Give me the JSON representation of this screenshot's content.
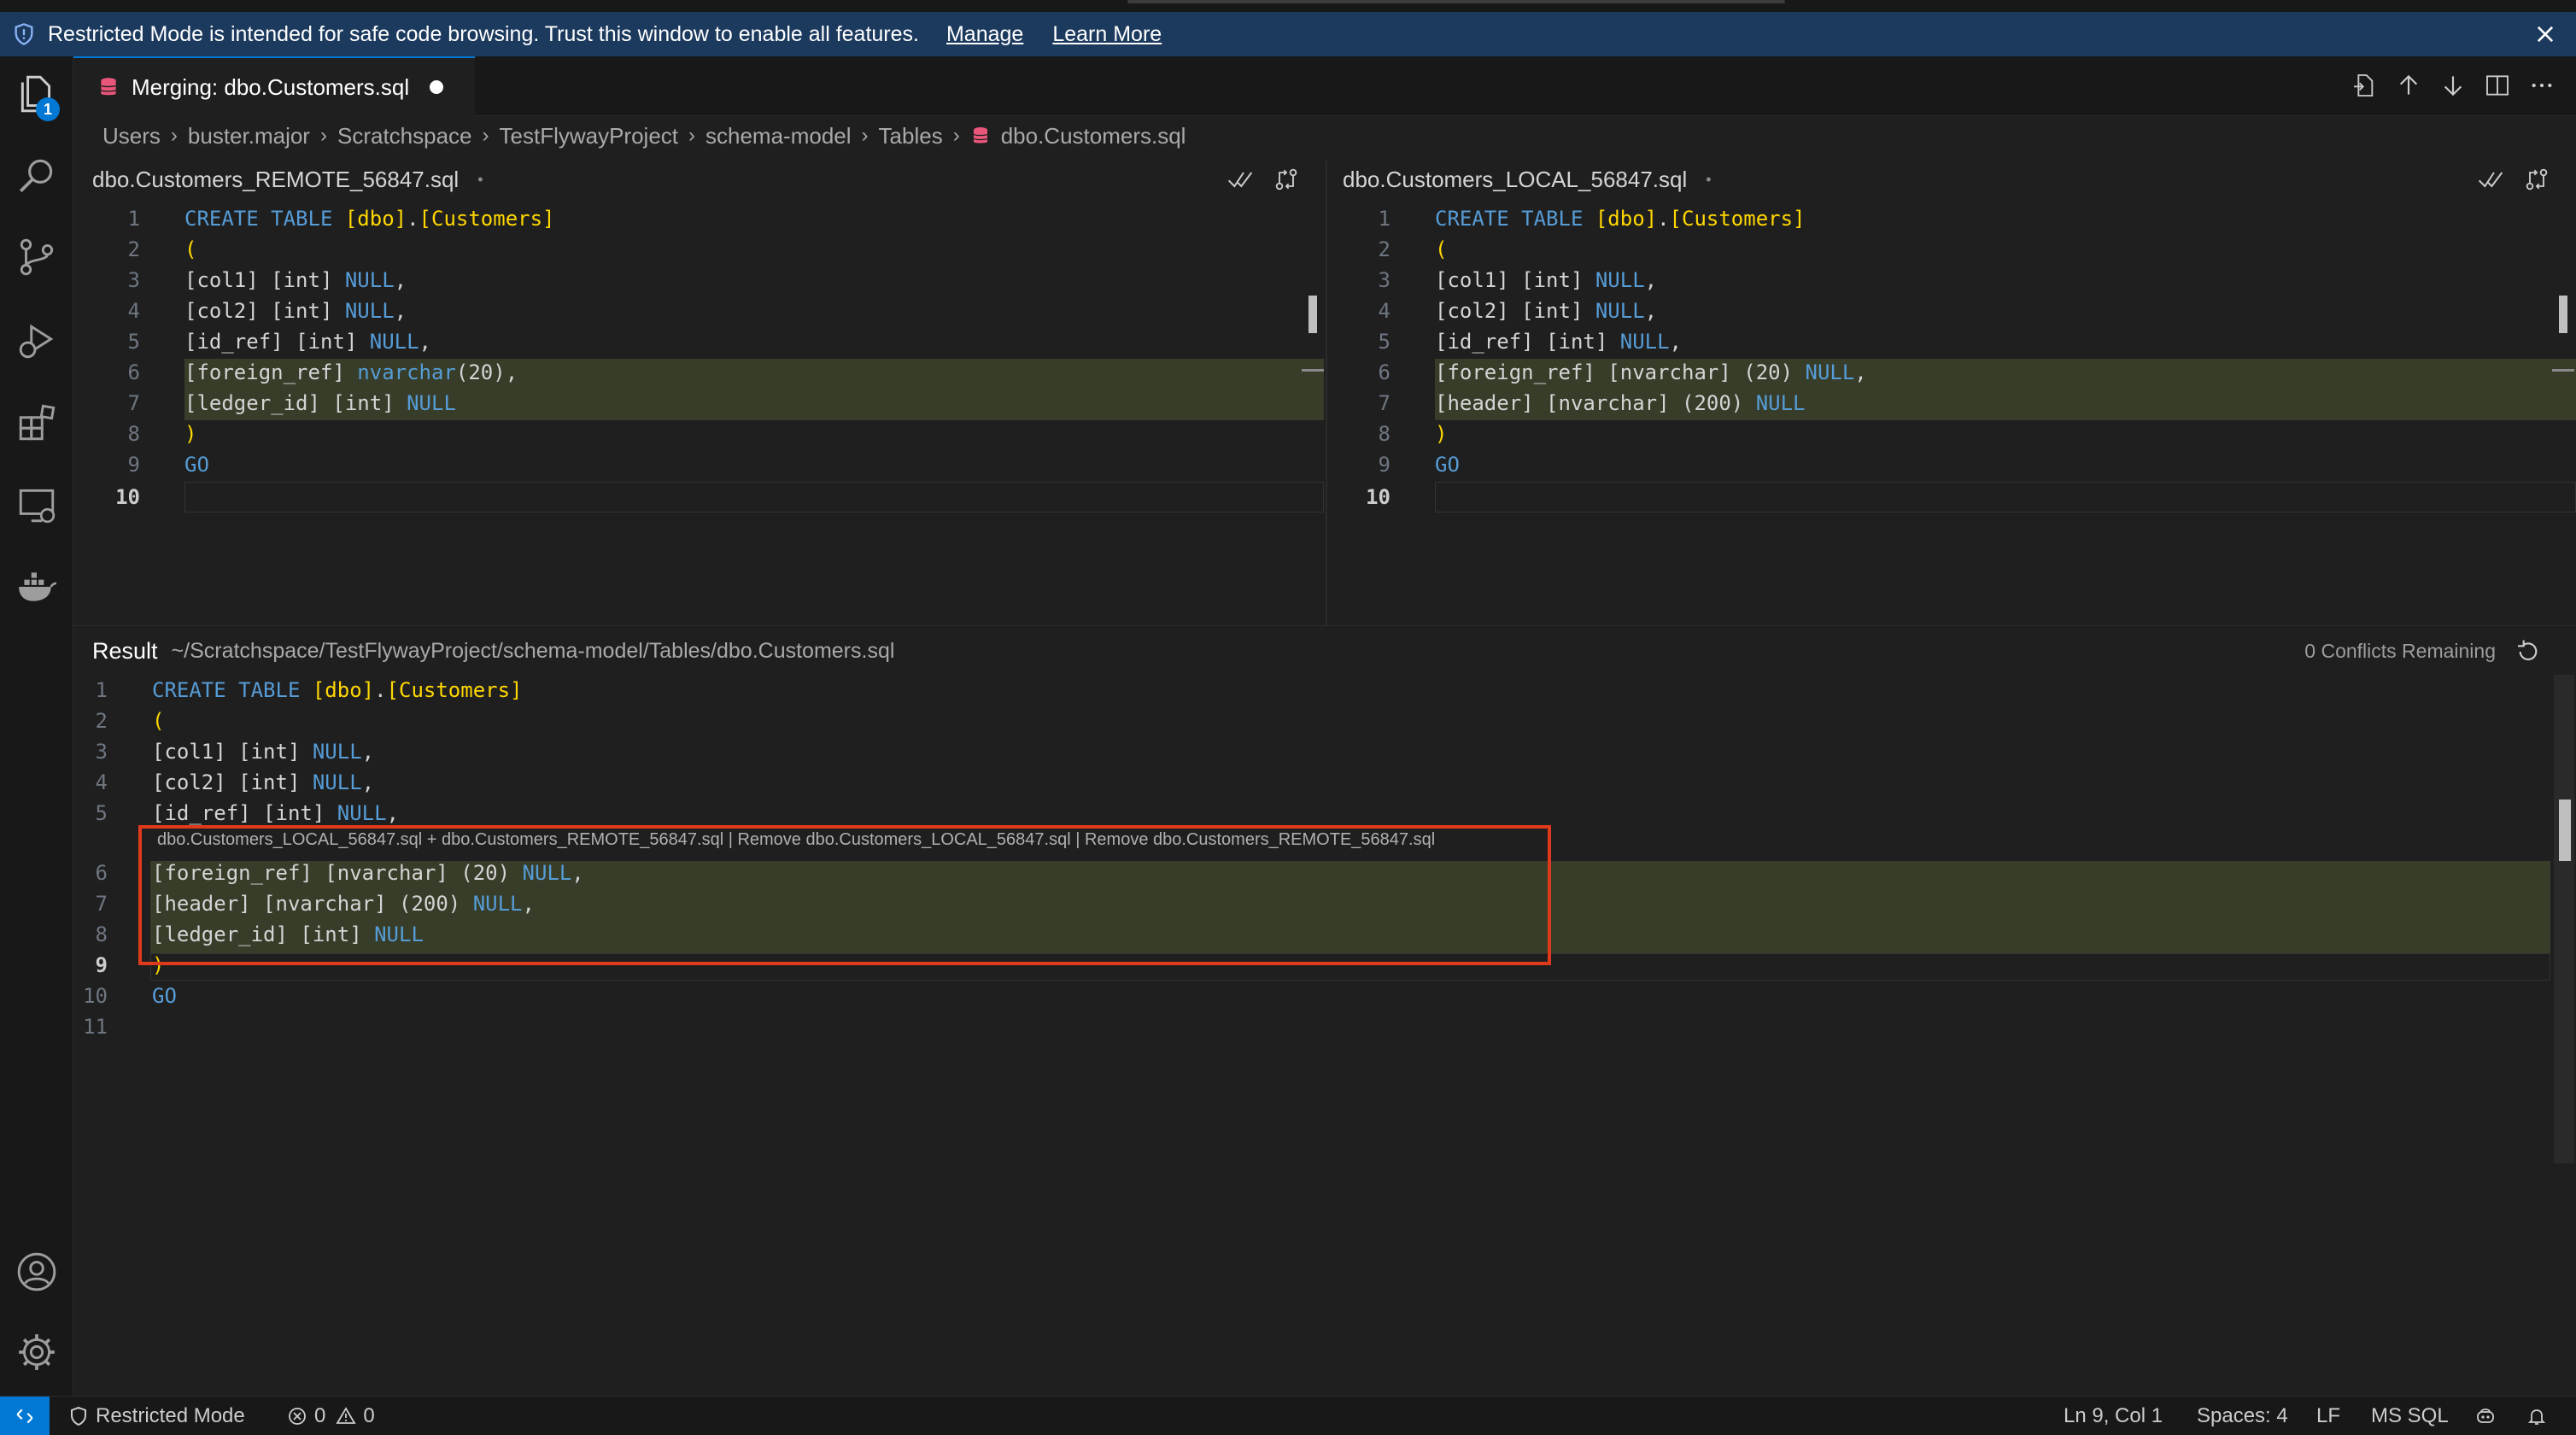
{
  "banner": {
    "message": "Restricted Mode is intended for safe code browsing. Trust this window to enable all features.",
    "manage": "Manage",
    "learn_more": "Learn More"
  },
  "activity": {
    "explorer_badge": "1"
  },
  "tab": {
    "title": "Merging: dbo.Customers.sql"
  },
  "breadcrumb": [
    "Users",
    "buster.major",
    "Scratchspace",
    "TestFlywayProject",
    "schema-model",
    "Tables",
    "dbo.Customers.sql"
  ],
  "left_pane": {
    "title": "dbo.Customers_REMOTE_56847.sql",
    "dot": "•",
    "line_numbers": [
      "1",
      "2",
      "3",
      "4",
      "5",
      "6",
      "7",
      "8",
      "9",
      "10"
    ],
    "current_line": "10"
  },
  "right_pane": {
    "title": "dbo.Customers_LOCAL_56847.sql",
    "dot": "•",
    "line_numbers": [
      "1",
      "2",
      "3",
      "4",
      "5",
      "6",
      "7",
      "8",
      "9",
      "10"
    ],
    "current_line": "10"
  },
  "result": {
    "title": "Result",
    "path": "~/Scratchspace/TestFlywayProject/schema-model/Tables/dbo.Customers.sql",
    "conflicts": "0 Conflicts Remaining",
    "codelens": "dbo.Customers_LOCAL_56847.sql + dbo.Customers_REMOTE_56847.sql | Remove dbo.Customers_LOCAL_56847.sql | Remove dbo.Customers_REMOTE_56847.sql",
    "line_numbers": [
      "1",
      "2",
      "3",
      "4",
      "5",
      "6",
      "7",
      "8",
      "9",
      "10",
      "11"
    ],
    "current_line": "9"
  },
  "code": {
    "create_kw": "CREATE TABLE",
    "dbo": "[dbo]",
    "dot": ".",
    "customers": "[Customers]",
    "open_paren": "(",
    "close_paren": ")",
    "go": "GO",
    "col1": "[col1]",
    "col2": "[col2]",
    "id_ref": "[id_ref]",
    "int": "[int]",
    "null": "NULL",
    "comma": ",",
    "foreign_ref": "[foreign_ref]",
    "nvarchar_plain": "nvarchar",
    "nvarchar_br": "[nvarchar]",
    "n20_paren": "(20)",
    "n20_space": "(20)",
    "header": "[header]",
    "n200": "(200)",
    "ledger_id": "[ledger_id]"
  },
  "status": {
    "restricted": "Restricted Mode",
    "errors": "0",
    "warnings": "0",
    "position": "Ln 9, Col 1",
    "spaces": "Spaces: 4",
    "eol": "LF",
    "language": "MS SQL"
  },
  "colors": {
    "accent": "#0078d4",
    "banner": "#1c3a5e",
    "highlight": "#373d29",
    "redbox": "#e03a1c",
    "keyword": "#569cd6",
    "bracket": "#ffd700"
  }
}
